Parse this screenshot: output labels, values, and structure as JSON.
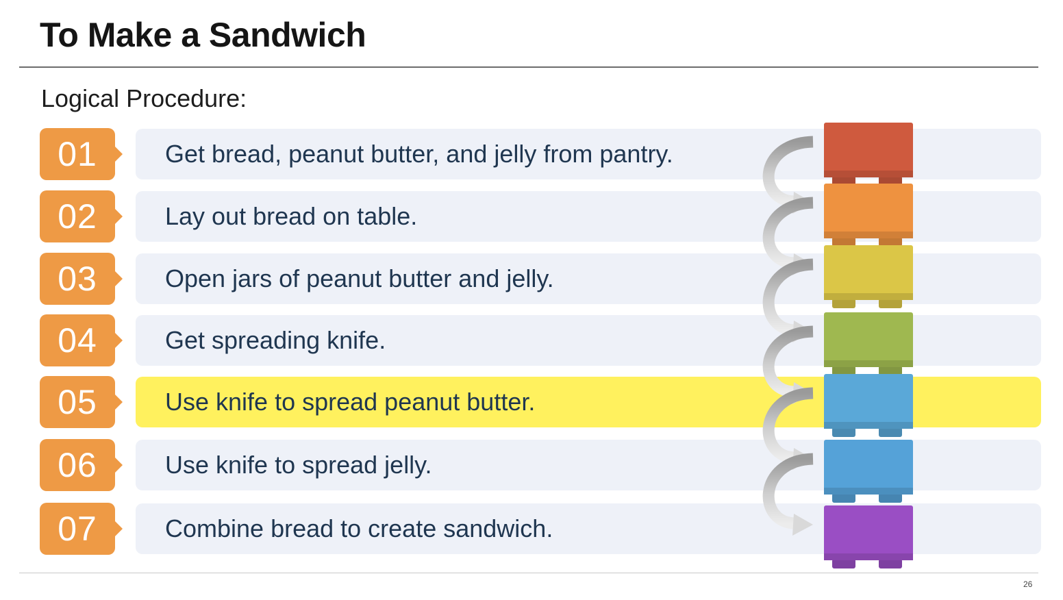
{
  "slide": {
    "title": "To Make a Sandwich",
    "subtitle": "Logical Procedure:",
    "page_number": "26"
  },
  "steps": [
    {
      "number": "01",
      "text": "Get bread, peanut butter, and jelly from pantry.",
      "highlighted": false,
      "block_color": "#cf5a3e"
    },
    {
      "number": "02",
      "text": "Lay out bread on table.",
      "highlighted": false,
      "block_color": "#ee9240"
    },
    {
      "number": "03",
      "text": "Open jars of peanut butter and jelly.",
      "highlighted": false,
      "block_color": "#dbc647"
    },
    {
      "number": "04",
      "text": "Get spreading knife.",
      "highlighted": false,
      "block_color": "#9fb850"
    },
    {
      "number": "05",
      "text": "Use knife to spread peanut butter.",
      "highlighted": true,
      "block_color": "#5aa8d8"
    },
    {
      "number": "06",
      "text": "Use knife to spread jelly.",
      "highlighted": false,
      "block_color": "#55a2d8"
    },
    {
      "number": "07",
      "text": "Combine bread to create sandwich.",
      "highlighted": false,
      "block_color": "#9a4ec4"
    }
  ],
  "colors": {
    "badge": "#ee9a45",
    "row_background": "#eef1f8",
    "highlight": "#fff15e",
    "arrow": "#b5b5b5",
    "step_text": "#1f3650"
  },
  "icons": {
    "connector": "curved-arrow-icon",
    "block": "building-block-icon"
  }
}
